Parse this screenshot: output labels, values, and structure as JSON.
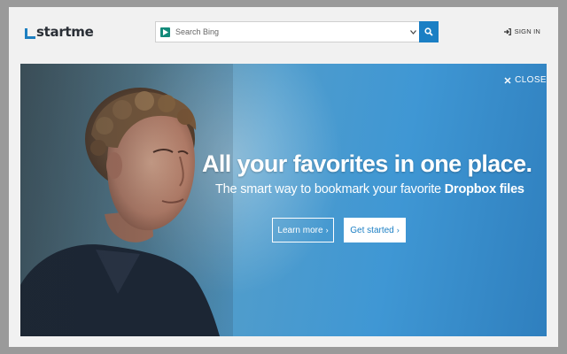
{
  "header": {
    "logo_text": "startme",
    "search_placeholder": "Search Bing",
    "signin_label": "SIGN IN"
  },
  "hero": {
    "close_label": "CLOSE",
    "headline": "All your favorites in one place.",
    "subline_prefix": "The smart way to bookmark your favorite ",
    "subline_bold": "Dropbox files",
    "learn_more_label": "Learn more",
    "get_started_label": "Get started"
  },
  "colors": {
    "accent": "#1b7fc4",
    "engine_icon": "#138a7a"
  },
  "icons": {
    "logo": "startme-logo-icon",
    "engine": "bing-play-icon",
    "dropdown": "chevron-down-icon",
    "search": "search-icon",
    "signin": "sign-in-icon",
    "close": "close-icon"
  }
}
